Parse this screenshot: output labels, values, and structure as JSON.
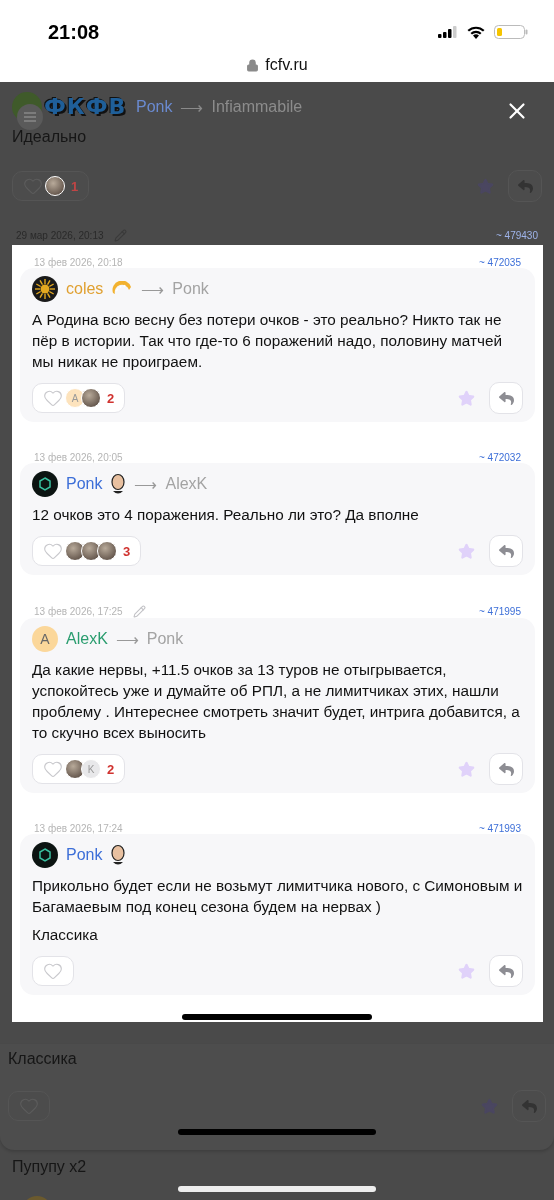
{
  "status_bar": {
    "time": "21:08"
  },
  "address_bar": {
    "url": "fcfv.ru"
  },
  "background_page": {
    "logo": "ФКФВ",
    "top_comment": {
      "author": "Ponk",
      "color": "#6a8ad0",
      "recipient": "Infiammabile",
      "arrow": "⟶",
      "text": "Идеально",
      "likes": {
        "count": "1",
        "avatars": [
          {
            "kind": "picture"
          }
        ]
      }
    },
    "next_comment": {
      "date": "29 мар 2026, 20:13",
      "edited": true,
      "id": "~ 479430"
    },
    "bottom_comment": {
      "text": "Классика"
    },
    "next_text": "Пупупу х2"
  },
  "viewer": {
    "comments": [
      {
        "date": "13 фев 2026, 20:18",
        "edited": false,
        "id": "~ 472035",
        "author": "coles",
        "color": "#e0a030",
        "avatar": {
          "kind": "sun"
        },
        "badge": {
          "kind": "pastry"
        },
        "arrow": "⟶",
        "recipient": "Ponk",
        "paragraphs": [
          "А Родина всю весну без потери очков - это реально? Никто так не пёр в истории. Так что где-то 6 поражений надо, половину матчей мы никак не проиграем."
        ],
        "likes": {
          "count": "2",
          "avatars": [
            {
              "kind": "letter",
              "letter": "A"
            },
            {
              "kind": "picture"
            }
          ]
        }
      },
      {
        "date": "13 фев 2026, 20:05",
        "edited": false,
        "id": "~ 472032",
        "author": "Ponk",
        "color": "#3d6fd8",
        "avatar": {
          "kind": "dark"
        },
        "badge": {
          "kind": "portrait"
        },
        "arrow": "⟶",
        "recipient": "AlexK",
        "paragraphs": [
          "12 очков это 4 поражения. Реально ли это? Да вполне"
        ],
        "likes": {
          "count": "3",
          "avatars": [
            {
              "kind": "picture"
            },
            {
              "kind": "picture"
            },
            {
              "kind": "picture"
            }
          ]
        }
      },
      {
        "date": "13 фев 2026, 17:25",
        "edited": true,
        "id": "~ 471995",
        "author": "AlexK",
        "color": "#2a9d6f",
        "avatar": {
          "kind": "letter",
          "letter": "A"
        },
        "arrow": "⟶",
        "recipient": "Ponk",
        "paragraphs": [
          "Да какие нервы, +11.5 очков за 13 туров не отыгрывается, успокойтесь уже и думайте об РПЛ, а не лимитчиках этих, нашли проблему . Интереснее смотреть значит будет, интрига добавится, а то скучно всех выносить"
        ],
        "likes": {
          "count": "2",
          "avatars": [
            {
              "kind": "picture"
            },
            {
              "kind": "letter",
              "letter": "K"
            }
          ]
        }
      },
      {
        "date": "13 фев 2026, 17:24",
        "edited": false,
        "id": "~ 471993",
        "author": "Ponk",
        "color": "#3d6fd8",
        "avatar": {
          "kind": "dark"
        },
        "badge": {
          "kind": "portrait"
        },
        "paragraphs": [
          "Прикольно будет если не возьмут лимитчика нового, с Симоновым и Багамаевым под конец сезона будем на нервах )",
          "Классика"
        ]
      }
    ]
  }
}
